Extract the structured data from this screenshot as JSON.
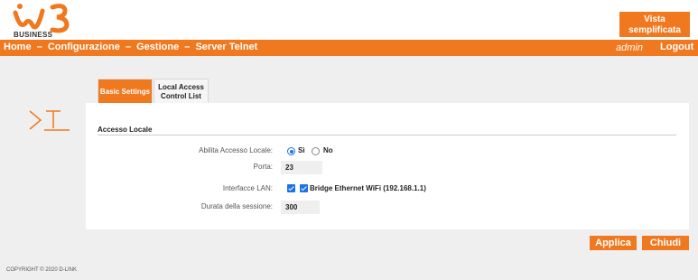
{
  "brand": {
    "logo_text": "BUSINESS",
    "accent_color": "#f0781e"
  },
  "header": {
    "simplified_view_label": "Vista semplificata"
  },
  "nav": {
    "breadcrumb": [
      "Home",
      "Configurazione",
      "Gestione",
      "Server Telnet"
    ],
    "separator": "–",
    "user": "admin",
    "logout_label": "Logout"
  },
  "page_icon": "telnet-icon",
  "tabs": [
    {
      "label": "Basic Settings",
      "active": true
    },
    {
      "label": "Local Access Control List",
      "active": false
    }
  ],
  "section": {
    "title": "Accesso Locale",
    "enable_label": "Abilita Accesso Locale:",
    "enable_options": [
      {
        "label": "Sì",
        "selected": true
      },
      {
        "label": "No",
        "selected": false
      }
    ],
    "port_label": "Porta:",
    "port_value": "23",
    "lan_label": "Interfacce LAN:",
    "lan_option_label": "Bridge Ethernet WiFi (192.168.1.1)",
    "session_label": "Durata della sessione:",
    "session_value": "300"
  },
  "actions": {
    "apply_label": "Applica",
    "close_label": "Chiudi"
  },
  "footer": {
    "copyright": "COPYRIGHT © 2020 D-LINK"
  }
}
